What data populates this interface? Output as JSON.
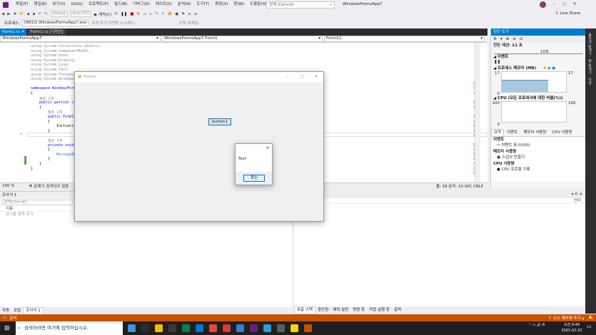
{
  "menubar": {
    "items": [
      "파일(F)",
      "편집(E)",
      "보기(V)",
      "Git(G)",
      "프로젝트(P)",
      "빌드(B)",
      "디버그(D)",
      "테스트(S)",
      "분석(N)",
      "도구(T)",
      "확장(X)",
      "창(W)",
      "도움말(H)"
    ],
    "search_placeholder": "검색 (Ctrl+Q)",
    "app_title": "WindowsFormsApp7",
    "live_share": "Live Share"
  },
  "toolbar": {
    "config": "Debug",
    "platform": "Any CPU",
    "continue": "계속(C)",
    "app_insights": "수명 주기 이벤트 ▾ 스레드:",
    "stack_frame": "스택 프레임:"
  },
  "debugbar": {
    "process_label": "프로세스:",
    "process": "[8832] WindowsFormsApp7.exe"
  },
  "doctabs": [
    {
      "label": "Form1.cs",
      "state": "active"
    },
    {
      "label": "Form1.cs [디자인]",
      "state": "inactive"
    }
  ],
  "navbar": {
    "project": "WindowsFormsApp7",
    "class": "WindowsFormsApp7.Form1",
    "member": "Form1()"
  },
  "editor": {
    "zoom": "100 %",
    "issues": "문제가 검색되지 않음",
    "position": "줄: 18   문자: 10   SPC   CRLF",
    "lines": [
      {
        "n": "2",
        "text": "using System.Collections.Generic;",
        "cls": "gr"
      },
      {
        "n": "3",
        "text": "using System.ComponentModel;",
        "cls": "gr"
      },
      {
        "n": "4",
        "text": "using System.Data;",
        "cls": "gr"
      },
      {
        "n": "5",
        "text": "using System.Drawing;",
        "cls": "gr"
      },
      {
        "n": "6",
        "text": "using System.Linq;",
        "cls": "gr"
      },
      {
        "n": "7",
        "text": "using System.Text;",
        "cls": "gr"
      },
      {
        "n": "8",
        "text": "using System.Threading.Tasks;",
        "cls": "gr"
      },
      {
        "n": "9",
        "text": "using System.Windows.Forms;",
        "cls": "gr"
      },
      {
        "n": "10",
        "text": "",
        "cls": ""
      },
      {
        "n": "11",
        "text": "namespace WindowsFormsApp7",
        "cls": "kwline"
      },
      {
        "n": "12",
        "text": "{",
        "cls": ""
      },
      {
        "n": "",
        "text": "    참조 2개",
        "cls": "cm"
      },
      {
        "n": "13",
        "text": "    public partial class Form1 : Form",
        "cls": "kwline"
      },
      {
        "n": "14",
        "text": "    {",
        "cls": ""
      },
      {
        "n": "",
        "text": "        참조 1개",
        "cls": "cm"
      },
      {
        "n": "15",
        "text": "        public Form1()",
        "cls": "kwline"
      },
      {
        "n": "16",
        "text": "        {",
        "cls": ""
      },
      {
        "n": "17",
        "text": "            InitializeComponent();",
        "cls": ""
      },
      {
        "n": "18",
        "text": "        }",
        "cls": ""
      },
      {
        "n": "19",
        "text": "",
        "cls": ""
      },
      {
        "n": "",
        "text": "        참조 1개",
        "cls": "cm"
      },
      {
        "n": "20",
        "text": "        private void button1_Click(object sender, EventArgs e)",
        "cls": "kwline"
      },
      {
        "n": "21",
        "text": "        {",
        "cls": ""
      },
      {
        "n": "22",
        "text": "            MessageBox.Show(\"Test\");",
        "cls": "ty"
      },
      {
        "n": "23",
        "text": "        }",
        "cls": ""
      },
      {
        "n": "24",
        "text": "    }",
        "cls": ""
      },
      {
        "n": "25",
        "text": "}",
        "cls": ""
      },
      {
        "n": "26",
        "text": "",
        "cls": ""
      }
    ]
  },
  "diag": {
    "title": "진단 도구",
    "session": "진단 세션: 11 초",
    "timeline_label": "10초",
    "events": "이벤트",
    "memory": "프로세스 메모리 (MB)",
    "mem_max": "17",
    "mem_min": "0",
    "mem_level": 0.62,
    "cpu": "CPU (모든 프로세서에 대한 비율(%))",
    "cpu_max": "100",
    "cpu_min": "0",
    "tabs": [
      "요약",
      "이벤트",
      "메모리 사용량",
      "CPU 사용량"
    ],
    "ev_head": "이벤트",
    "ev_item": "이벤트 표시(0/0)",
    "mem_head": "메모리 사용량",
    "mem_item": "스냅샷 만들기",
    "cpu_head": "CPU 사용량",
    "cpu_item": "CPU 프로필 기록"
  },
  "watch": {
    "title": "조사식 1",
    "search_placeholder": "검색(Ctrl+E)",
    "col_name": "이름",
    "add_item": "감시할 항목 추가",
    "tabs": [
      "자동",
      "로컬",
      "조사식 1"
    ]
  },
  "output": {
    "col": "언어",
    "tabs": [
      "호출 스택",
      "중단점",
      "예외 설정",
      "명령 창",
      "직접 실행 창",
      "출력"
    ]
  },
  "statusbar": {
    "left": "준비",
    "right": "↑ 소스 제어에 추가 ▴"
  },
  "taskbar": {
    "search": "검색하려면 여기에 입력하십시오.",
    "time": "오전 9:48",
    "date": "2021-02-22",
    "icons": [
      "#3a96dd",
      "#2d2d30",
      "#ffb900",
      "#3a3a3a",
      "#0a7e4a",
      "#0078d7",
      "#e04a3a",
      "#d43a3a",
      "#3a7bd5",
      "#68217a",
      "#2d9cdb",
      "#5d5d5d",
      "#f7d21a",
      "#ca5100"
    ]
  },
  "form1": {
    "title": "Form1",
    "button": "button1"
  },
  "msgbox": {
    "text": "Test",
    "ok": "확인"
  }
}
